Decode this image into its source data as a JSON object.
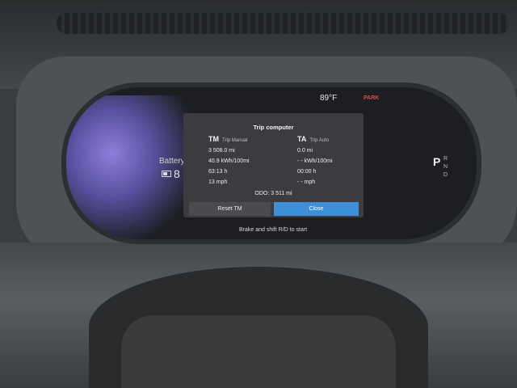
{
  "status": {
    "temperature": "89°F",
    "park_indicator": "PARK"
  },
  "battery": {
    "label": "Battery",
    "value": "8"
  },
  "gear_selector": {
    "current": "P",
    "options": [
      "R",
      "N",
      "D"
    ]
  },
  "trip_computer": {
    "title": "Trip computer",
    "trip_manual": {
      "abbr": "TM",
      "name": "Trip Manual",
      "distance": "3 508.0 mi",
      "consumption": "40.9 kWh/100mi",
      "time": "63:13 h",
      "speed": "13 mph"
    },
    "trip_auto": {
      "abbr": "TA",
      "name": "Trip Auto",
      "distance": "0.0 mi",
      "consumption": "- - kWh/100mi",
      "time": "00:00 h",
      "speed": "- - mph"
    },
    "odometer": "ODO:  3 511 mi",
    "reset_label": "Reset TM",
    "close_label": "Close"
  },
  "hint_text": "Brake and shift R/D to start",
  "colors": {
    "accent_button": "#3f8fd6",
    "park_red": "#e04848",
    "screen_bg": "#1c1e22",
    "popup_bg": "#3c3c40"
  },
  "icons": [
    "battery-icon"
  ]
}
